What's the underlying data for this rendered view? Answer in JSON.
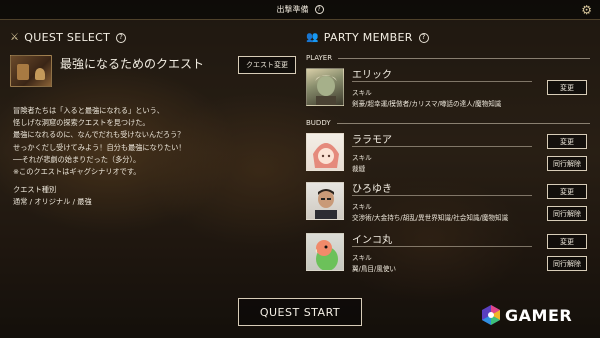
{
  "topbar": {
    "title": "出撃準備",
    "help": "?"
  },
  "quest": {
    "section_title": "QUEST SELECT",
    "help": "?",
    "title": "最強になるためのクエスト",
    "change_button": "クエスト変更",
    "description": [
      "冒険者たちは「入ると最強になれる」という、",
      "怪しげな洞窟の探索クエストを見つけた。",
      "最強になれるのに、なんでだれも受けないんだろう？",
      "せっかくだし受けてみよう！自分も最強になりたい！",
      "──それが悲劇の始まりだった（多分）。",
      "※このクエストはギャグシナリオです。"
    ],
    "type_label": "クエスト種別",
    "type_value": "通常 / オリジナル / 最強"
  },
  "party": {
    "section_title": "PARTY MEMBER",
    "help": "?",
    "player_label": "PLAYER",
    "buddy_label": "BUDDY",
    "change_label": "変更",
    "leave_label": "同行解除",
    "skill_label": "スキル",
    "player": {
      "name": "エリック",
      "skills": "剣豪/超幸運/模倣者/カリスマ/噂話の達人/魔物知識"
    },
    "buddies": [
      {
        "name": "ララモア",
        "skills": "裁縫"
      },
      {
        "name": "ひろゆき",
        "skills": "交渉術/大金持ち/胡乱/異世界知識/社会知識/魔物知識"
      },
      {
        "name": "インコ丸",
        "skills": "翼/鳥目/風使い"
      }
    ]
  },
  "start_button": "QUEST START",
  "watermark": "GAMER"
}
